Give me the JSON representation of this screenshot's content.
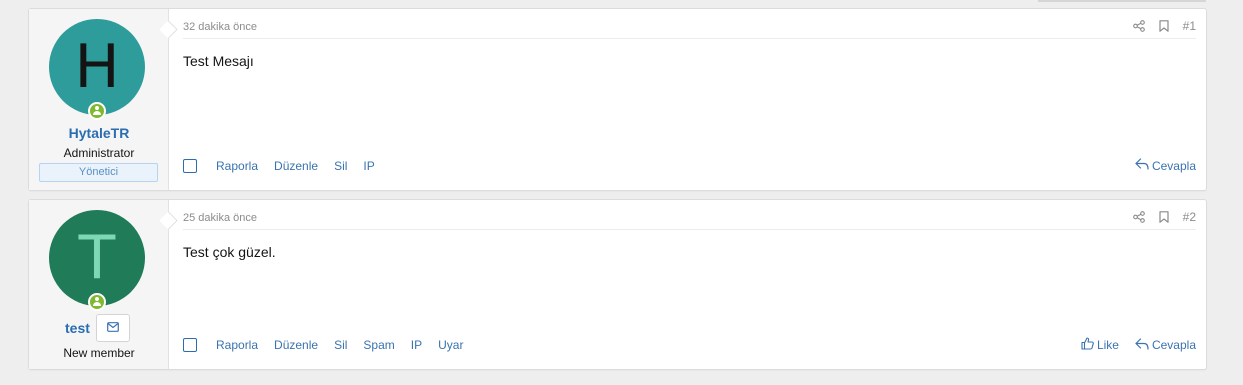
{
  "posts": [
    {
      "date": "32 dakika önce",
      "number": "#1",
      "message": "Test Mesajı",
      "user": {
        "avatar_letter": "H",
        "avatar_color": "#2e9c9a",
        "name": "HytaleTR",
        "title": "Administrator",
        "banner": "Yönetici"
      },
      "actions": [
        "Raporla",
        "Düzenle",
        "Sil",
        "IP"
      ],
      "reply_label": "Cevapla",
      "icons": [
        "share-icon",
        "bookmark-icon",
        "reply-icon"
      ]
    },
    {
      "date": "25 dakika önce",
      "number": "#2",
      "message": "Test çok güzel.",
      "user": {
        "avatar_letter": "T",
        "avatar_color": "#1f7b58",
        "name": "test",
        "title": "New member"
      },
      "actions": [
        "Raporla",
        "Düzenle",
        "Sil",
        "Spam",
        "IP",
        "Uyar"
      ],
      "like_label": "Like",
      "reply_label": "Cevapla",
      "icons": [
        "share-icon",
        "bookmark-icon",
        "envelope-icon",
        "thumbs-up-icon",
        "reply-icon"
      ]
    }
  ],
  "colors": {
    "link": "#3a73b0",
    "online": "#7fb92f",
    "banner_border": "#b6d4ef"
  }
}
